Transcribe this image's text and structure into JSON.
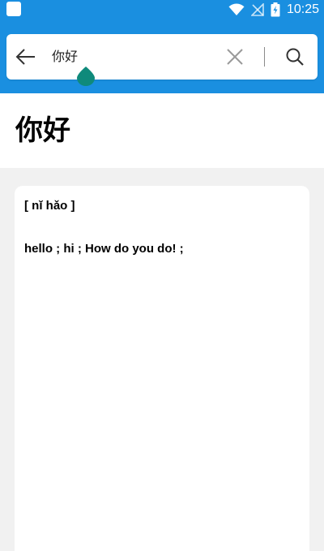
{
  "status_bar": {
    "time": "10:25",
    "icons": [
      "app-notification-icon",
      "wifi-icon",
      "no-signal-icon",
      "battery-charging-icon"
    ]
  },
  "search": {
    "query": "你好",
    "back_icon": "arrow-left-icon",
    "clear_icon": "close-icon",
    "submit_icon": "search-icon"
  },
  "entry": {
    "headword": "你好",
    "pinyin": "[ nǐ hǎo ]",
    "translation": "hello ; hi ; How do you do! ;"
  },
  "colors": {
    "topbar": "#1a8fe0",
    "cursor_handle": "#0f8a7b",
    "background": "#f1f1f1"
  }
}
